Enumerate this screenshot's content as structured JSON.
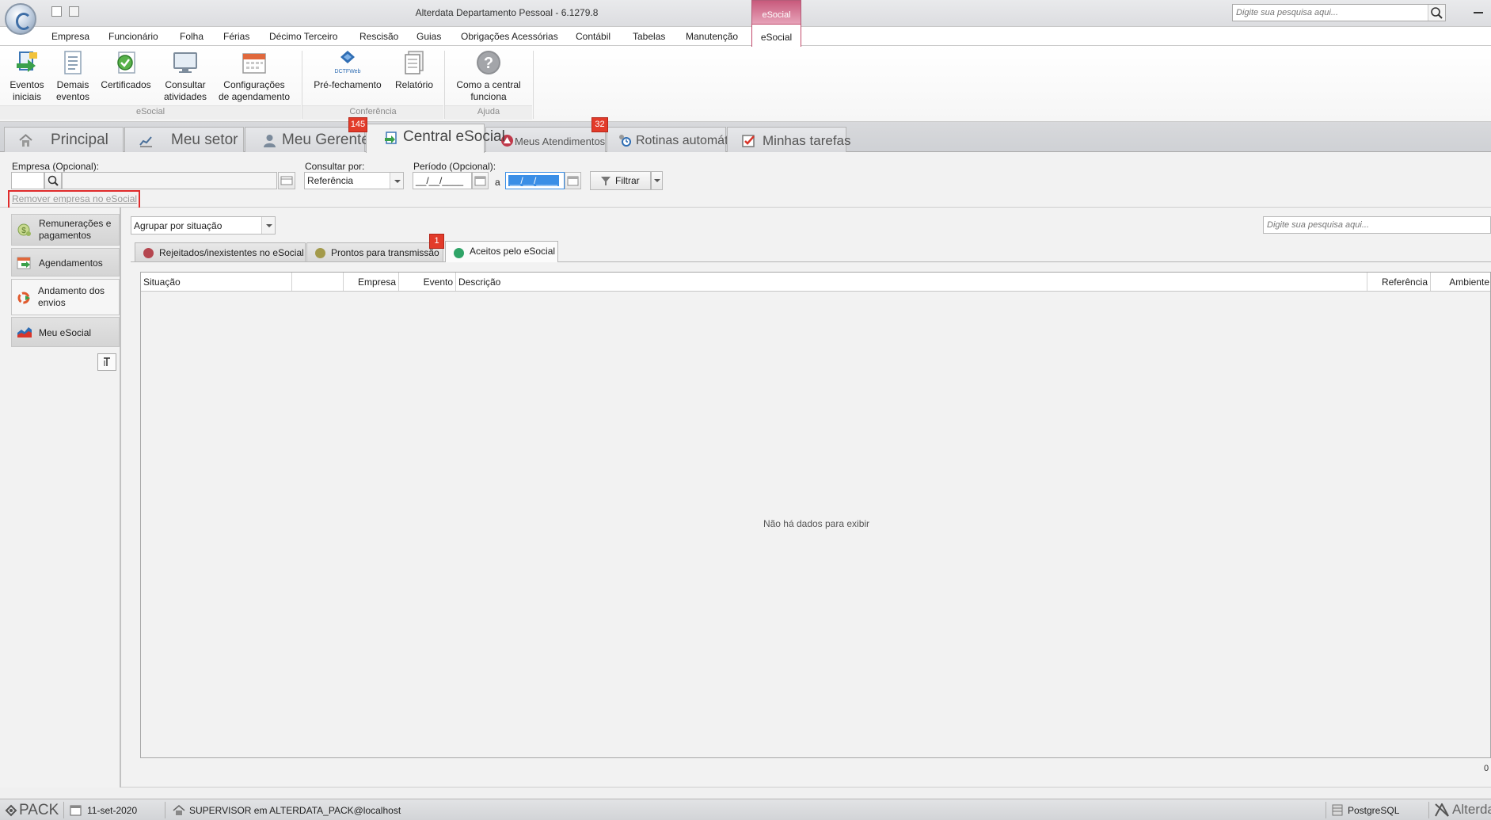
{
  "window": {
    "title": "Alterdata Departamento Pessoal - 6.1279.8",
    "context_tab": "eSocial",
    "search_placeholder": "Digite sua pesquisa aqui..."
  },
  "menu": [
    "Empresa",
    "Funcionário",
    "Folha",
    "Férias",
    "Décimo Terceiro",
    "Rescisão",
    "Guias",
    "Obrigações Acessórias",
    "Contábil",
    "Tabelas",
    "Manutenção",
    "eSocial"
  ],
  "menu_active": "eSocial",
  "ribbon": {
    "groups": {
      "esocial": {
        "label": "eSocial",
        "items": [
          {
            "l1": "Eventos",
            "l2": "iniciais"
          },
          {
            "l1": "Demais",
            "l2": "eventos"
          },
          {
            "l1": "Certificados",
            "l2": ""
          },
          {
            "l1": "Consultar",
            "l2": "atividades"
          },
          {
            "l1": "Configurações",
            "l2": "de agendamento"
          }
        ]
      },
      "conferencia": {
        "label": "Conferência",
        "items": [
          {
            "l1": "Pré-fechamento",
            "l2": "",
            "icon_text": "DCTFWeb"
          },
          {
            "l1": "Relatório",
            "l2": ""
          }
        ]
      },
      "ajuda": {
        "label": "Ajuda",
        "items": [
          {
            "l1": "Como a central",
            "l2": "funciona"
          }
        ]
      }
    }
  },
  "tabs": [
    {
      "label": "Principal",
      "icon": "home-icon"
    },
    {
      "label": "Meu setor",
      "icon": "chart-icon"
    },
    {
      "label": "Meu Gerente",
      "icon": "user-icon",
      "badge": "145"
    },
    {
      "label": "Central eSocial",
      "icon": "esocial-icon"
    },
    {
      "label": "Meus Atendimentos",
      "icon": "support-icon",
      "badge": "32"
    },
    {
      "label": "Rotinas automáticas",
      "icon": "clock-icon"
    },
    {
      "label": "Minhas tarefas",
      "icon": "checklist-icon"
    }
  ],
  "filter": {
    "empresa_label": "Empresa (Opcional):",
    "consultar_label": "Consultar por:",
    "consultar_value": "Referência",
    "periodo_label": "Período (Opcional):",
    "date_from": "__/__/____",
    "date_to": "__/__/____",
    "a_label": "a",
    "filtrar_label": "Filtrar",
    "remove_link": "Remover empresa no eSocial"
  },
  "left_nav": [
    {
      "l1": "Remunerações e",
      "l2": "pagamentos"
    },
    {
      "l1": "Agendamentos",
      "l2": ""
    },
    {
      "l1": "Andamento dos",
      "l2": "envios"
    },
    {
      "l1": "Meu eSocial",
      "l2": ""
    }
  ],
  "main": {
    "group_by": "Agrupar por situação",
    "search_placeholder": "Digite sua pesquisa aqui...",
    "subtabs": [
      {
        "label": "Rejeitados/inexistentes no eSocial",
        "color": "#b5464f"
      },
      {
        "label": "Prontos para transmissão",
        "color": "#a39a4a",
        "badge": "1"
      },
      {
        "label": "Aceitos pelo eSocial",
        "color": "#2fa467"
      }
    ],
    "columns": [
      "Situação",
      "",
      "Empresa",
      "Evento",
      "Descrição",
      "Referência",
      "Ambiente"
    ],
    "empty_message": "Não há dados para exibir",
    "row_count": "0"
  },
  "status": {
    "brand": "PACK",
    "date": "11-set-2020",
    "user": "SUPERVISOR em ALTERDATA_PACK@localhost",
    "db": "PostgreSQL",
    "logo": "Alterdata"
  },
  "colors": {
    "accent": "#c24a6b",
    "badge": "#e23b2a",
    "highlight_border": "#e02b2b",
    "selected_date": "#3a8ee6"
  }
}
